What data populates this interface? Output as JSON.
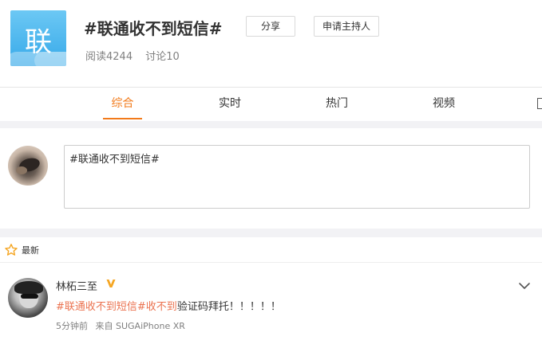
{
  "topic": {
    "logo_char": "联",
    "title": "#联通收不到短信#",
    "reads": "阅读4244",
    "discussions": "讨论10",
    "share_label": "分享",
    "apply_host_label": "申请主持人"
  },
  "tabs": [
    {
      "label": "综合",
      "active": true
    },
    {
      "label": "实时",
      "active": false
    },
    {
      "label": "热门",
      "active": false
    },
    {
      "label": "视频",
      "active": false
    }
  ],
  "composer": {
    "text": "#联通收不到短信#"
  },
  "latest": {
    "label": "最新",
    "icon": "star-icon"
  },
  "post": {
    "username": "林柘三至",
    "verified_icon": "verified-v-icon",
    "tag1": "#联通收不到短信#",
    "tag2": "收不到",
    "text_rest": "验证码拜托！！！！！",
    "time": "5分钟前",
    "source": "来自 SUGAiPhone XR"
  },
  "colors": {
    "accent": "#f27a1a",
    "tag": "#eb7350",
    "verified": "#f5a623",
    "logo_bg": "#4ab6ee"
  }
}
